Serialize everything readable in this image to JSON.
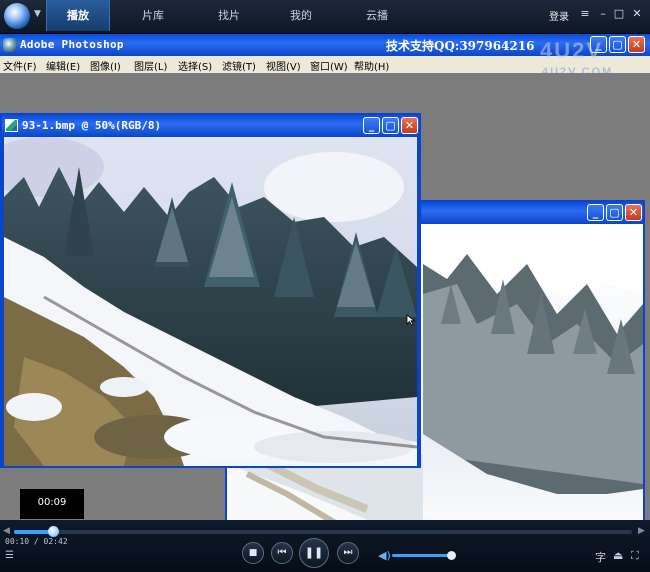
{
  "player": {
    "tabs": [
      {
        "label": "播放",
        "active": true
      },
      {
        "label": "片库",
        "active": false
      },
      {
        "label": "找片",
        "active": false
      },
      {
        "label": "我的",
        "active": false
      },
      {
        "label": "云播",
        "active": false
      }
    ],
    "login_label": "登录",
    "window_buttons": {
      "menu": "≡",
      "minimize": "–",
      "maximize": "□",
      "close": "✕"
    }
  },
  "photoshop": {
    "app_title": "Adobe Photoshop",
    "support_text": "技术支持QQ:397964216",
    "watermark_big": "4U2V",
    "watermark_small": "4U2V.COM",
    "menu": [
      "文件(F)",
      "编辑(E)",
      "图像(I)",
      "图层(L)",
      "选择(S)",
      "滤镜(T)",
      "视图(V)",
      "窗口(W)",
      "帮助(H)"
    ],
    "document_title": "93-1.bmp @ 50%(RGB/8)"
  },
  "tooltip_time": "00:09",
  "controls": {
    "current_time": "00:10",
    "total_time": "02:42",
    "time_separator": " / ",
    "progress_fraction": 0.063,
    "volume_fraction": 0.95,
    "stop_icon": "■",
    "prev_icon": "⏮",
    "pause_icon": "❚❚",
    "next_icon": "⏭",
    "volume_icon": "◀)",
    "subtitle_icon": "字",
    "eject_icon": "⏏",
    "fullscreen_icon": "⛶",
    "playlist_icon": "☰"
  }
}
